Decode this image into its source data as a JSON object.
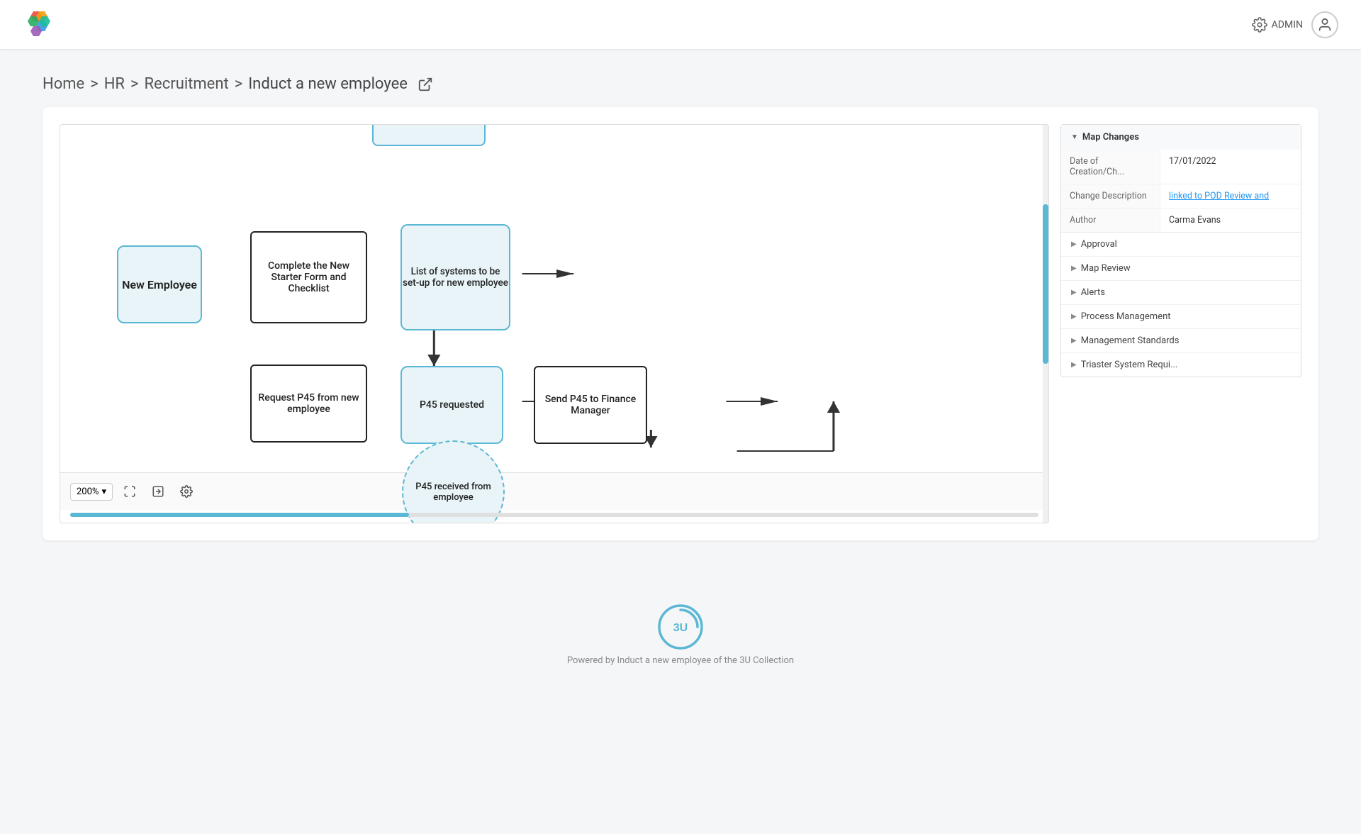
{
  "header": {
    "admin_label": "ADMIN"
  },
  "breadcrumb": {
    "home": "Home",
    "sep1": ">",
    "hr": "HR",
    "sep2": ">",
    "recruitment": "Recruitment",
    "sep3": ">",
    "current": "Induct a new employee"
  },
  "diagram": {
    "nodes": {
      "new_employee": "New Employee",
      "complete_starter": "Complete the New Starter Form and Checklist",
      "list_systems": "List of systems to be set-up for new employee",
      "request_p45": "Request P45 from new employee",
      "p45_requested": "P45 requested",
      "send_p45": "Send P45 to Finance Manager",
      "p45_received": "P45 received from employee"
    },
    "toolbar": {
      "zoom": "200%"
    }
  },
  "side_panel": {
    "map_changes_title": "Map Changes",
    "rows": [
      {
        "label": "Date of Creation/Ch...",
        "value": "17/01/2022"
      },
      {
        "label": "Change Description",
        "value": "linked to POD Review and",
        "is_link": true
      },
      {
        "label": "Author",
        "value": "Carma Evans"
      }
    ],
    "collapsible": [
      "Approval",
      "Map Review",
      "Alerts",
      "Process Management",
      "Management Standards",
      "Triaster System Requi..."
    ]
  },
  "footer": {
    "logo_text": "3U",
    "tagline": "Powered by Induct a new employee of the 3U Collection"
  }
}
